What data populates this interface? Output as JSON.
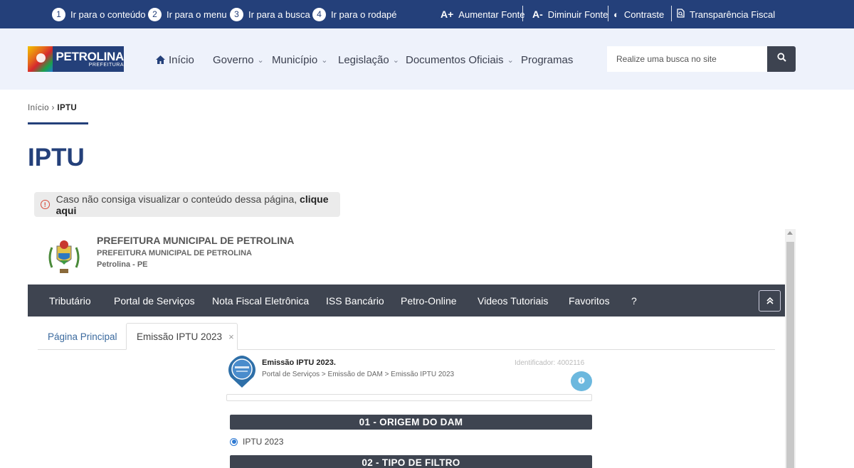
{
  "accessibility_bar": {
    "skip_links": [
      {
        "num": "1",
        "label": "Ir para o conteúdo"
      },
      {
        "num": "2",
        "label": "Ir para o menu"
      },
      {
        "num": "3",
        "label": "Ir para a busca"
      },
      {
        "num": "4",
        "label": "Ir para o rodapé"
      }
    ],
    "increase_font": {
      "icon": "A+",
      "label": "Aumentar Fonte"
    },
    "decrease_font": {
      "icon": "A-",
      "label": "Diminuir Fonte"
    },
    "contrast": {
      "icon": "◐",
      "label": "Contraste"
    },
    "transparency": {
      "icon": "document-search-icon",
      "label": "Transparência Fiscal"
    }
  },
  "header": {
    "logo": {
      "name": "PETROLINA",
      "sub": "PREFEITURA"
    },
    "nav": [
      {
        "label": "Início",
        "icon": "home-icon"
      },
      {
        "label": "Governo",
        "has_dropdown": true
      },
      {
        "label": "Município",
        "has_dropdown": true
      },
      {
        "label": "Legislação",
        "has_dropdown": true
      },
      {
        "label": "Documentos Oficiais",
        "has_dropdown": true
      },
      {
        "label": "Programas"
      }
    ],
    "search": {
      "placeholder": "Realize uma busca no site",
      "value": ""
    }
  },
  "breadcrumb": {
    "home": "Início",
    "separator": "›",
    "current": "IPTU"
  },
  "page_title": "IPTU",
  "alert": {
    "text": "Caso não consiga visualizar o conteúdo dessa página,",
    "link": "clique aqui"
  },
  "embedded": {
    "org_title": "PREFEITURA MUNICIPAL DE PETROLINA",
    "org_subtitle": "PREFEITURA MUNICIPAL DE PETROLINA",
    "org_city": "Petrolina - PE",
    "nav": [
      "Tributário",
      "Portal de Serviços",
      "Nota Fiscal Eletrônica",
      "ISS Bancário",
      "Petro-Online",
      "Videos Tutoriais",
      "Favoritos",
      "?"
    ],
    "tabs": [
      {
        "label": "Página Principal"
      },
      {
        "label": "Emissão IPTU 2023",
        "active": true,
        "close": "×"
      }
    ],
    "service": {
      "title": "Emissão IPTU 2023.",
      "path": "Portal de Serviços > Emissão de DAM > Emissão IPTU 2023",
      "identifier": "Identificador: 4002116"
    },
    "sections": [
      {
        "title": "01 - ORIGEM DO DAM"
      },
      {
        "title": "02 - TIPO DE FILTRO"
      }
    ],
    "origin_option": {
      "label": "IPTU 2023",
      "selected": true
    }
  },
  "colors": {
    "primary": "#24407a",
    "header_bg": "#eef2fb",
    "dark_nav": "#3e4450",
    "info": "#6cb8de"
  }
}
